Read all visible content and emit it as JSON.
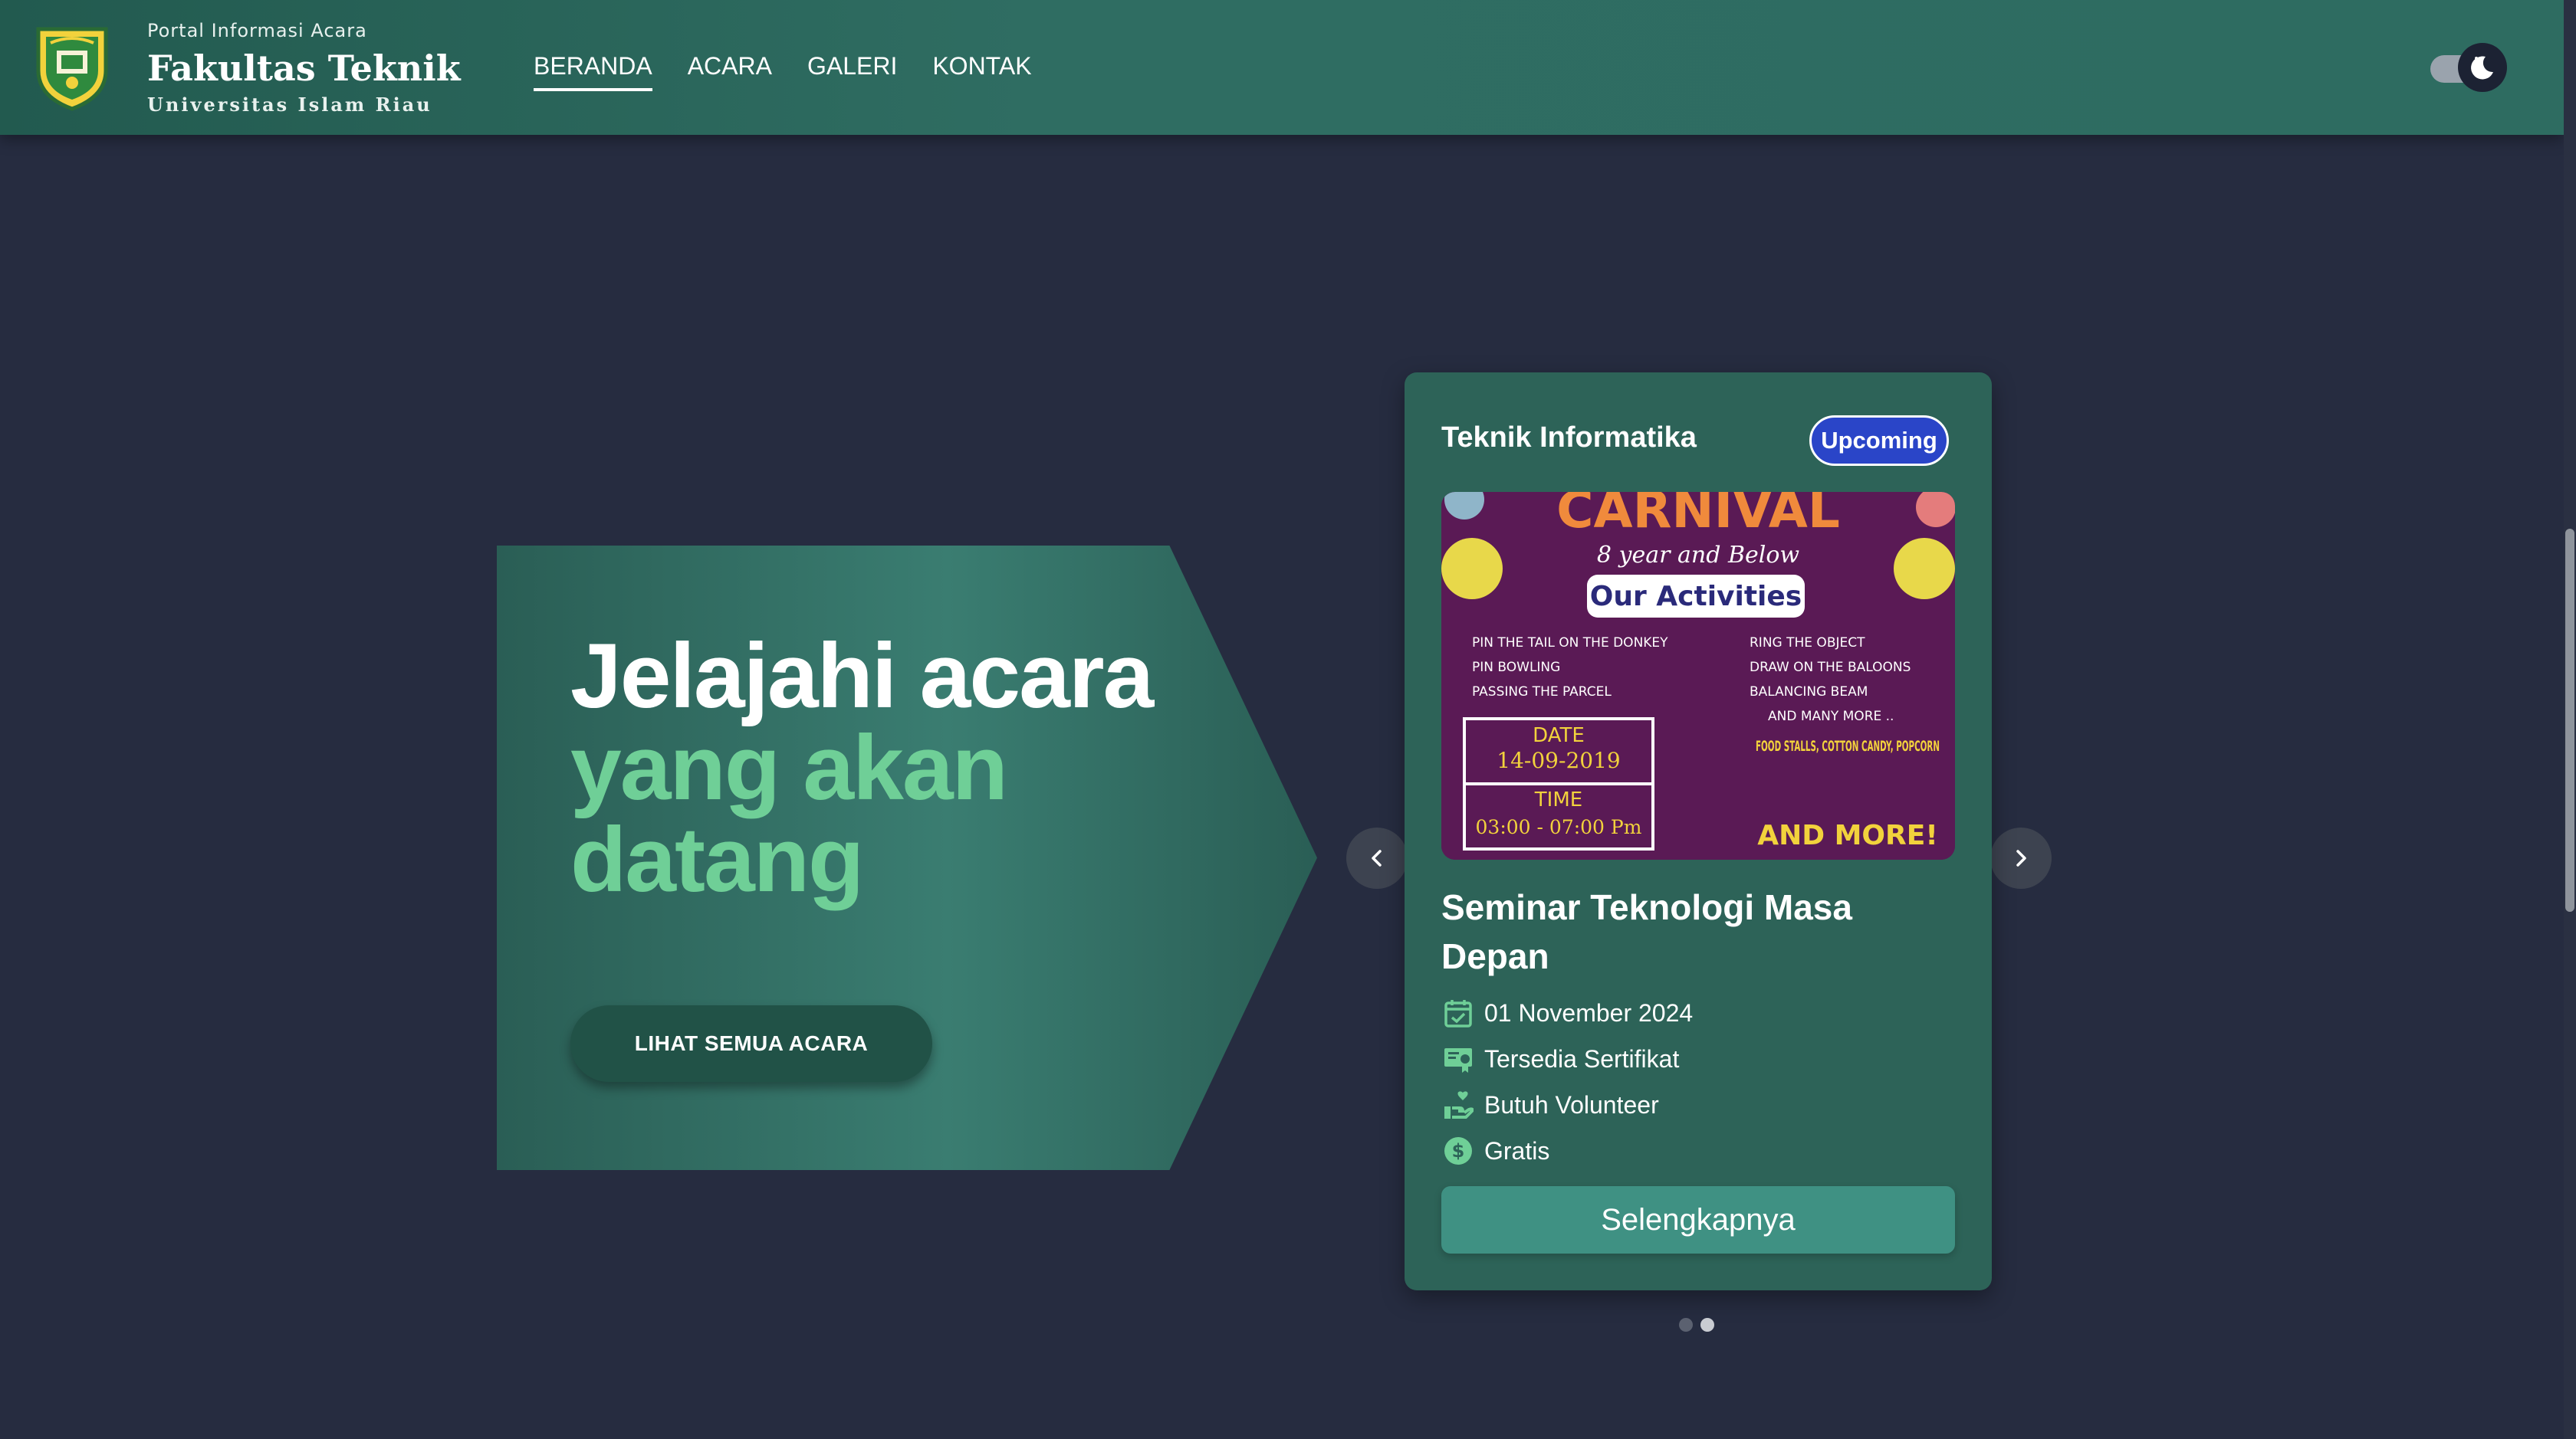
{
  "header": {
    "subtitle": "Portal Informasi Acara",
    "title": "Fakultas Teknik",
    "university": "Universitas Islam Riau",
    "nav": [
      {
        "label": "BERANDA",
        "active": true
      },
      {
        "label": "ACARA",
        "active": false
      },
      {
        "label": "GALERI",
        "active": false
      },
      {
        "label": "KONTAK",
        "active": false
      }
    ],
    "theme_toggle_icon": "moon-icon"
  },
  "hero": {
    "line1": "Jelajahi acara",
    "line2": "yang akan",
    "line3": "datang",
    "button_label": "LIHAT SEMUA ACARA",
    "accent_color": "#6fcf97"
  },
  "event_card": {
    "department": "Teknik Informatika",
    "badge": "Upcoming",
    "badge_color": "#2a45c8",
    "title": "Seminar Teknologi Masa Depan",
    "date": "01 November 2024",
    "certificate": "Tersedia Sertifikat",
    "volunteer": "Butuh Volunteer",
    "price": "Gratis",
    "button_label": "Selengkapnya",
    "poster": {
      "heading": "CARNIVAL",
      "subheading": "8 year and Below",
      "section": "Our Activities",
      "activities_left": [
        "PIN THE TAIL ON THE DONKEY",
        "PIN BOWLING",
        "PASSING THE PARCEL"
      ],
      "activities_right": [
        "RING THE OBJECT",
        "DRAW ON THE BALOONS",
        "BALANCING BEAM",
        "AND MANY MORE .."
      ],
      "date_label": "DATE",
      "date_value": "14-09-2019",
      "time_label": "TIME",
      "time_value": "03:00 - 07:00 Pm",
      "extras": "FOOD STALLS, COTTON CANDY, POPCORN",
      "more": "AND MORE!"
    }
  },
  "carousel": {
    "slide_count": 2,
    "active_slide": 2
  }
}
